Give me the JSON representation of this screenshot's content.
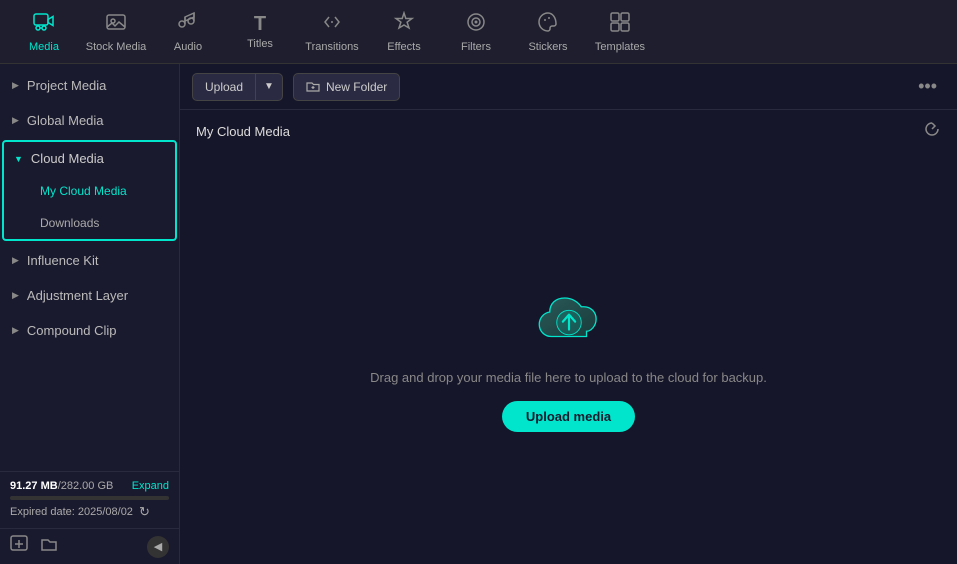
{
  "toolbar": {
    "items": [
      {
        "id": "media",
        "label": "Media",
        "icon": "🎬",
        "active": true
      },
      {
        "id": "stock-media",
        "label": "Stock Media",
        "icon": "🖼️",
        "active": false
      },
      {
        "id": "audio",
        "label": "Audio",
        "icon": "🎵",
        "active": false
      },
      {
        "id": "titles",
        "label": "Titles",
        "icon": "T",
        "active": false
      },
      {
        "id": "transitions",
        "label": "Transitions",
        "icon": "⇄",
        "active": false
      },
      {
        "id": "effects",
        "label": "Effects",
        "icon": "✦",
        "active": false
      },
      {
        "id": "filters",
        "label": "Filters",
        "icon": "◈",
        "active": false
      },
      {
        "id": "stickers",
        "label": "Stickers",
        "icon": "⬡",
        "active": false
      },
      {
        "id": "templates",
        "label": "Templates",
        "icon": "⊞",
        "active": false
      }
    ]
  },
  "sidebar": {
    "items": [
      {
        "id": "project-media",
        "label": "Project Media",
        "expanded": false
      },
      {
        "id": "global-media",
        "label": "Global Media",
        "expanded": false
      },
      {
        "id": "cloud-media",
        "label": "Cloud Media",
        "expanded": true,
        "children": [
          {
            "id": "my-cloud-media",
            "label": "My Cloud Media",
            "active": true
          },
          {
            "id": "downloads",
            "label": "Downloads",
            "active": false
          }
        ]
      },
      {
        "id": "influence-kit",
        "label": "Influence Kit",
        "expanded": false
      },
      {
        "id": "adjustment-layer",
        "label": "Adjustment Layer",
        "expanded": false
      },
      {
        "id": "compound-clip",
        "label": "Compound Clip",
        "expanded": false
      }
    ],
    "storage": {
      "used": "91.27 MB",
      "total": "282.00 GB",
      "expand_label": "Expand",
      "expired_label": "Expired date: 2025/08/02"
    }
  },
  "content": {
    "toolbar": {
      "upload_label": "Upload",
      "new_folder_label": "New Folder",
      "more_icon": "•••"
    },
    "section_title": "My Cloud Media",
    "refresh_title": "Refresh",
    "empty_state": {
      "drag_text": "Drag and drop your media file here to upload to the cloud for backup.",
      "upload_btn_label": "Upload media"
    }
  }
}
